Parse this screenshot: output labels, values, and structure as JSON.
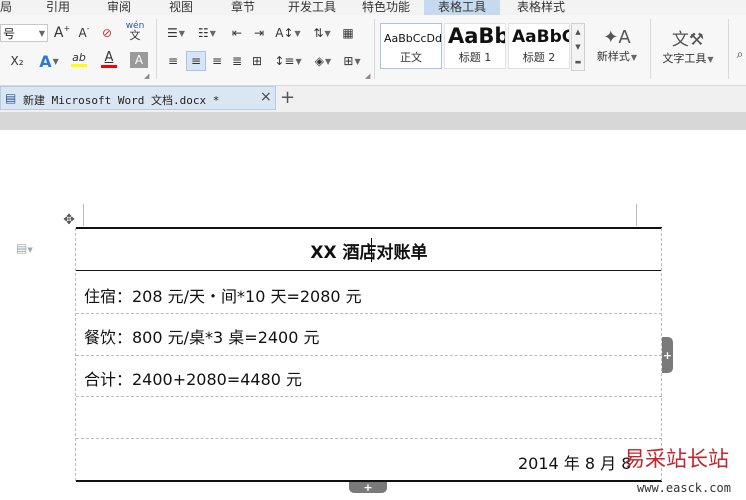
{
  "menu": {
    "items": [
      "局",
      "引用",
      "审阅",
      "视图",
      "章节",
      "开发工具",
      "特色功能",
      "表格工具",
      "表格样式"
    ]
  },
  "ribbon": {
    "font_size_value": "号",
    "font_grow": "A",
    "font_shrink": "A",
    "clear_format": "⊘",
    "phonetic": "wén",
    "subscript": "X₂",
    "text_effect": "A",
    "highlight": "ab",
    "font_color": "A",
    "char_shading": "A",
    "styles": [
      {
        "preview": "AaBbCcDd",
        "name": "正文"
      },
      {
        "preview": "AaBb",
        "name": "标题 1"
      },
      {
        "preview": "AaBbC",
        "name": "标题 2"
      }
    ],
    "new_style_label": "新样式",
    "text_tools_label": "文字工具",
    "colors": {
      "font_color_bar": "#ff0000",
      "highlight_bar": "#ffff00",
      "accent": "#2b579a"
    }
  },
  "tabs": {
    "doc_title": "新建 Microsoft Word 文档.docx *",
    "close": "×",
    "add": "+"
  },
  "document": {
    "title": "XX 酒店对账单",
    "rows": [
      "住宿：208 元/天・间*10 天=2080 元",
      "餐饮：800 元/桌*3 桌=2400 元",
      "合计：2400+2080=4480 元",
      ""
    ],
    "date": "2014 年 8 月 8",
    "add_row_label": "+",
    "add_col_label": "+",
    "move_handle": "✥"
  },
  "watermark": {
    "brand": "易采站长站",
    "url": "www.easck.com"
  }
}
